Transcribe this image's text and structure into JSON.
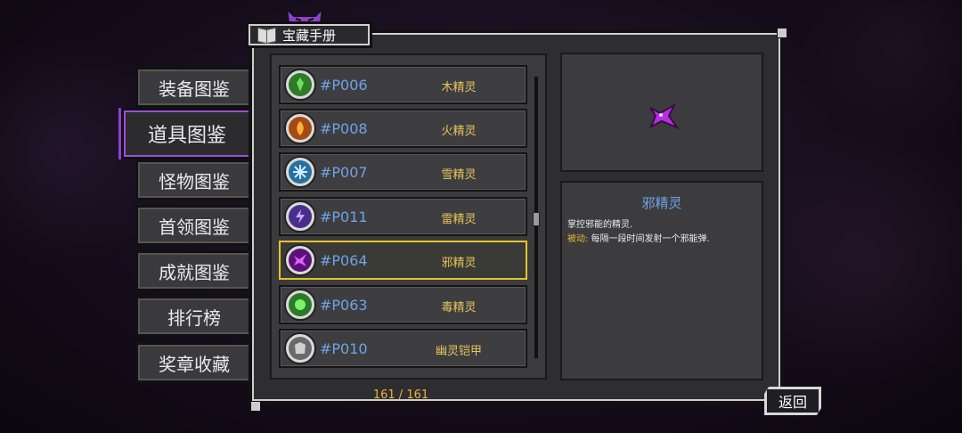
{
  "title": "宝藏手册",
  "side_tabs": [
    {
      "label": "装备图鉴",
      "active": false
    },
    {
      "label": "道具图鉴",
      "active": true
    },
    {
      "label": "怪物图鉴",
      "active": false
    },
    {
      "label": "首领图鉴",
      "active": false
    },
    {
      "label": "成就图鉴",
      "active": false
    },
    {
      "label": "排行榜",
      "active": false
    },
    {
      "label": "奖章收藏",
      "active": false
    }
  ],
  "items": [
    {
      "code": "#P006",
      "name": "木精灵",
      "icon": "wood-spirit-icon",
      "color": "#3fa53a"
    },
    {
      "code": "#P008",
      "name": "火精灵",
      "icon": "fire-spirit-icon",
      "color": "#e87a1e"
    },
    {
      "code": "#P007",
      "name": "雪精灵",
      "icon": "snow-spirit-icon",
      "color": "#4aa8e0"
    },
    {
      "code": "#P011",
      "name": "雷精灵",
      "icon": "thunder-spirit-icon",
      "color": "#7a4fd0"
    },
    {
      "code": "#P064",
      "name": "邪精灵",
      "icon": "evil-spirit-icon",
      "color": "#a323c8",
      "selected": true
    },
    {
      "code": "#P063",
      "name": "毒精灵",
      "icon": "poison-spirit-icon",
      "color": "#3fbf3a"
    },
    {
      "code": "#P010",
      "name": "幽灵铠甲",
      "icon": "ghost-armor-icon",
      "color": "#9a9a9a"
    }
  ],
  "page_count": "161 / 161",
  "detail": {
    "name": "邪精灵",
    "desc1": "掌控邪能的精灵.",
    "passive_label": "被动:",
    "passive_text": " 每隔一段时间发射一个邪能弹."
  },
  "back_label": "返回"
}
